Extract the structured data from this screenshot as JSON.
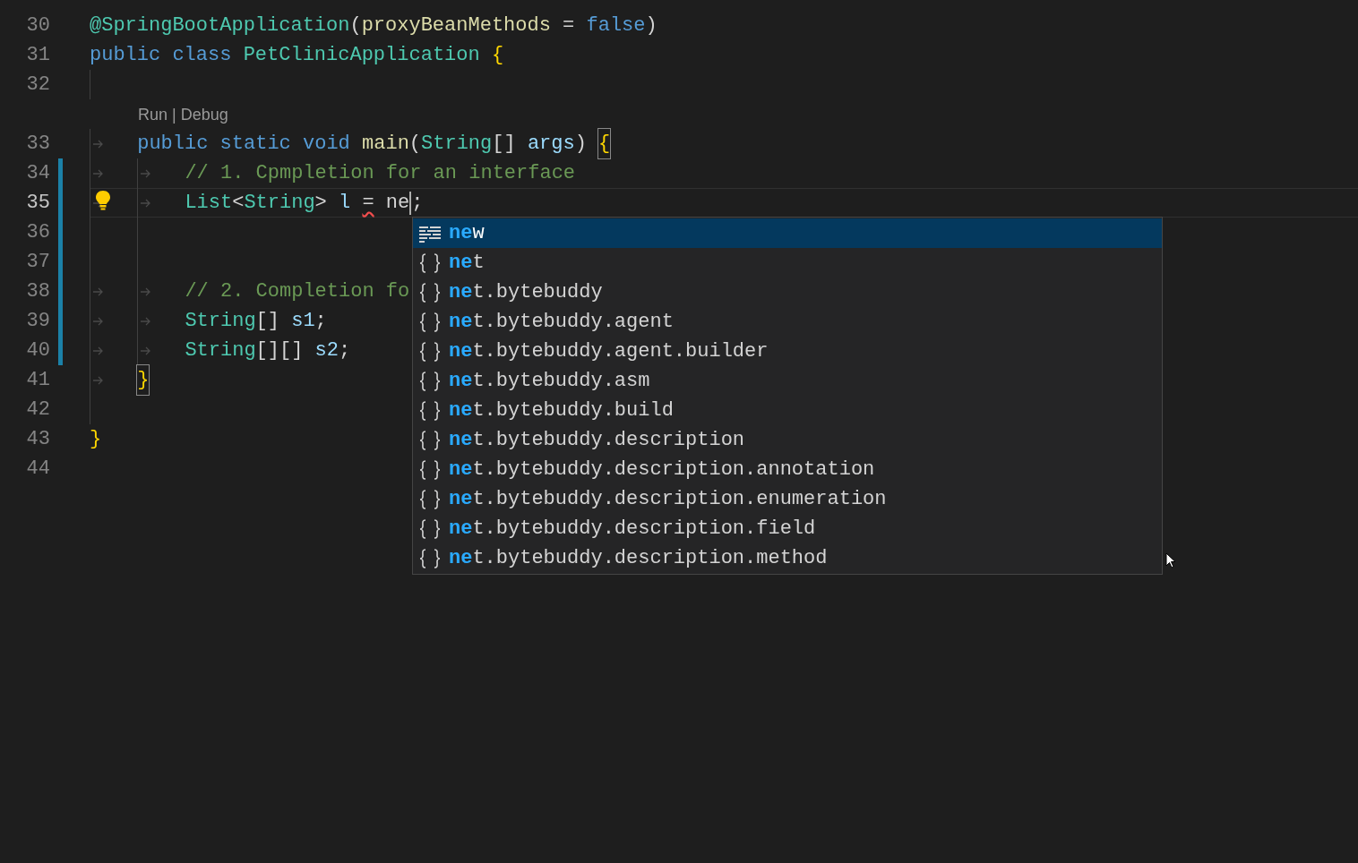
{
  "editor": {
    "lines": [
      {
        "number": "30",
        "tokens": [
          {
            "text": "@SpringBootApplication",
            "kind": "type"
          },
          {
            "text": "(",
            "kind": "punct"
          },
          {
            "text": "proxyBeanMethods",
            "kind": "method"
          },
          {
            "text": " = ",
            "kind": "punct"
          },
          {
            "text": "false",
            "kind": "keyword"
          },
          {
            "text": ")",
            "kind": "punct"
          }
        ]
      },
      {
        "number": "31",
        "tokens": [
          {
            "text": "public class ",
            "kind": "keyword"
          },
          {
            "text": "PetClinicApplication ",
            "kind": "type"
          },
          {
            "text": "{",
            "kind": "bracket"
          }
        ]
      },
      {
        "number": "32",
        "tokens": [
          {
            "kind": "indent"
          }
        ]
      },
      {
        "kind": "codelens",
        "text": "Run | Debug"
      },
      {
        "number": "33",
        "tokens": [
          {
            "kind": "tab"
          },
          {
            "text": "public static void ",
            "kind": "keyword"
          },
          {
            "text": "main",
            "kind": "method"
          },
          {
            "text": "(",
            "kind": "punct"
          },
          {
            "text": "String",
            "kind": "type"
          },
          {
            "text": "[] ",
            "kind": "punct"
          },
          {
            "text": "args",
            "kind": "variable"
          },
          {
            "text": ") ",
            "kind": "punct"
          },
          {
            "text": "{",
            "kind": "bracket-match"
          }
        ]
      },
      {
        "number": "34",
        "modified": true,
        "tokens": [
          {
            "kind": "tab"
          },
          {
            "kind": "tab"
          },
          {
            "text": "// 1. Cpmpletion for an interface",
            "kind": "comment"
          }
        ]
      },
      {
        "number": "35",
        "modified": true,
        "current": true,
        "lightbulb": true,
        "tokens": [
          {
            "kind": "tab"
          },
          {
            "kind": "tab"
          },
          {
            "text": "List",
            "kind": "type"
          },
          {
            "text": "<",
            "kind": "punct"
          },
          {
            "text": "String",
            "kind": "type"
          },
          {
            "text": "> ",
            "kind": "punct"
          },
          {
            "text": "l ",
            "kind": "variable"
          },
          {
            "text": "=",
            "kind": "error"
          },
          {
            "text": " ne",
            "kind": "punct"
          },
          {
            "kind": "cursor"
          },
          {
            "text": ";",
            "kind": "punct"
          }
        ]
      },
      {
        "number": "36",
        "modified": true,
        "tokens": [
          {
            "kind": "indent"
          },
          {
            "kind": "indent"
          }
        ]
      },
      {
        "number": "37",
        "modified": true,
        "tokens": [
          {
            "kind": "indent"
          },
          {
            "kind": "indent"
          }
        ]
      },
      {
        "number": "38",
        "modified": true,
        "tokens": [
          {
            "kind": "tab"
          },
          {
            "kind": "tab"
          },
          {
            "text": "// 2. Completion fo",
            "kind": "comment"
          }
        ]
      },
      {
        "number": "39",
        "modified": true,
        "tokens": [
          {
            "kind": "tab"
          },
          {
            "kind": "tab"
          },
          {
            "text": "String",
            "kind": "type"
          },
          {
            "text": "[] ",
            "kind": "punct"
          },
          {
            "text": "s1",
            "kind": "variable"
          },
          {
            "text": ";",
            "kind": "punct"
          }
        ]
      },
      {
        "number": "40",
        "modified": true,
        "tokens": [
          {
            "kind": "tab"
          },
          {
            "kind": "tab"
          },
          {
            "text": "String",
            "kind": "type"
          },
          {
            "text": "[][] ",
            "kind": "punct"
          },
          {
            "text": "s2",
            "kind": "variable"
          },
          {
            "text": ";",
            "kind": "punct"
          }
        ]
      },
      {
        "number": "41",
        "tokens": [
          {
            "kind": "tab"
          },
          {
            "text": "}",
            "kind": "bracket-match"
          }
        ]
      },
      {
        "number": "42",
        "tokens": [
          {
            "kind": "indent"
          }
        ]
      },
      {
        "number": "43",
        "tokens": [
          {
            "text": "}",
            "kind": "bracket"
          }
        ]
      },
      {
        "number": "44"
      }
    ]
  },
  "suggestions": [
    {
      "label": "**ne**w",
      "kind": "keyword",
      "selected": true
    },
    {
      "label": "**ne**t",
      "kind": "module",
      "selected": false
    },
    {
      "label": "**ne**t.bytebuddy",
      "kind": "module",
      "selected": false
    },
    {
      "label": "**ne**t.bytebuddy.agent",
      "kind": "module",
      "selected": false
    },
    {
      "label": "**ne**t.bytebuddy.agent.builder",
      "kind": "module",
      "selected": false
    },
    {
      "label": "**ne**t.bytebuddy.asm",
      "kind": "module",
      "selected": false
    },
    {
      "label": "**ne**t.bytebuddy.build",
      "kind": "module",
      "selected": false
    },
    {
      "label": "**ne**t.bytebuddy.description",
      "kind": "module",
      "selected": false
    },
    {
      "label": "**ne**t.bytebuddy.description.annotation",
      "kind": "module",
      "selected": false
    },
    {
      "label": "**ne**t.bytebuddy.description.enumeration",
      "kind": "module",
      "selected": false
    },
    {
      "label": "**ne**t.bytebuddy.description.field",
      "kind": "module",
      "selected": false
    },
    {
      "label": "**ne**t.bytebuddy.description.method",
      "kind": "module",
      "selected": false
    }
  ]
}
